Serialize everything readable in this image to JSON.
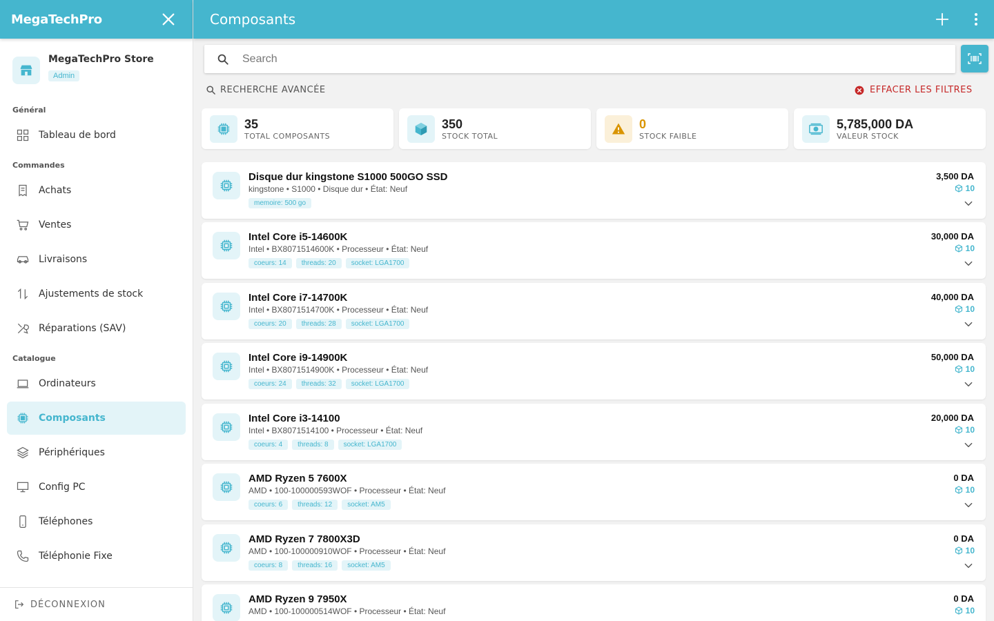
{
  "sidebar": {
    "brand": "MegaTechPro",
    "store_name": "MegaTechPro Store",
    "store_role": "Admin",
    "sections": [
      "Général",
      "Commandes",
      "Catalogue"
    ],
    "items": [
      {
        "label": "Tableau de bord",
        "icon": "grid-icon"
      },
      {
        "label": "Achats",
        "icon": "receipt-icon"
      },
      {
        "label": "Ventes",
        "icon": "cart-icon"
      },
      {
        "label": "Livraisons",
        "icon": "car-icon"
      },
      {
        "label": "Ajustements de stock",
        "icon": "swap-vertical-icon"
      },
      {
        "label": "Réparations (SAV)",
        "icon": "tools-icon"
      },
      {
        "label": "Ordinateurs",
        "icon": "laptop-icon"
      },
      {
        "label": "Composants",
        "icon": "chip-icon",
        "active": true
      },
      {
        "label": "Périphériques",
        "icon": "layers-icon"
      },
      {
        "label": "Config PC",
        "icon": "monitor-icon"
      },
      {
        "label": "Téléphones",
        "icon": "phone-icon"
      },
      {
        "label": "Téléphonie Fixe",
        "icon": "landline-icon"
      }
    ],
    "logout_label": "DÉCONNEXION"
  },
  "header": {
    "title": "Composants"
  },
  "search": {
    "placeholder": "Search"
  },
  "filters": {
    "advanced_label": "RECHERCHE AVANCÉE",
    "clear_label": "EFFACER LES FILTRES"
  },
  "stats": [
    {
      "value": "35",
      "label": "TOTAL COMPOSANTS",
      "icon": "chip-icon"
    },
    {
      "value": "350",
      "label": "STOCK TOTAL",
      "icon": "cube-icon"
    },
    {
      "value": "0",
      "label": "STOCK FAIBLE",
      "icon": "warning-icon"
    },
    {
      "value": "5,785,000 DA",
      "label": "VALEUR STOCK",
      "icon": "money-icon"
    }
  ],
  "products": [
    {
      "name": "Disque dur kingstone S1000 500GO SSD",
      "subtitle": "kingstone • S1000 • Disque dur • État: Neuf",
      "tags": [
        "memoire: 500 go"
      ],
      "price": "3,500 DA",
      "stock": "10"
    },
    {
      "name": "Intel Core i5-14600K",
      "subtitle": "Intel • BX8071514600K • Processeur • État: Neuf",
      "tags": [
        "coeurs: 14",
        "threads: 20",
        "socket: LGA1700"
      ],
      "price": "30,000 DA",
      "stock": "10"
    },
    {
      "name": "Intel Core i7-14700K",
      "subtitle": "Intel • BX8071514700K • Processeur • État: Neuf",
      "tags": [
        "coeurs: 20",
        "threads: 28",
        "socket: LGA1700"
      ],
      "price": "40,000 DA",
      "stock": "10"
    },
    {
      "name": "Intel Core i9-14900K",
      "subtitle": "Intel • BX8071514900K • Processeur • État: Neuf",
      "tags": [
        "coeurs: 24",
        "threads: 32",
        "socket: LGA1700"
      ],
      "price": "50,000 DA",
      "stock": "10"
    },
    {
      "name": "Intel Core i3-14100",
      "subtitle": "Intel • BX8071514100 • Processeur • État: Neuf",
      "tags": [
        "coeurs: 4",
        "threads: 8",
        "socket: LGA1700"
      ],
      "price": "20,000 DA",
      "stock": "10"
    },
    {
      "name": "AMD Ryzen 5 7600X",
      "subtitle": "AMD • 100-100000593WOF • Processeur • État: Neuf",
      "tags": [
        "coeurs: 6",
        "threads: 12",
        "socket: AM5"
      ],
      "price": "0 DA",
      "stock": "10"
    },
    {
      "name": "AMD Ryzen 7 7800X3D",
      "subtitle": "AMD • 100-100000910WOF • Processeur • État: Neuf",
      "tags": [
        "coeurs: 8",
        "threads: 16",
        "socket: AM5"
      ],
      "price": "0 DA",
      "stock": "10"
    },
    {
      "name": "AMD Ryzen 9 7950X",
      "subtitle": "AMD • 100-100000514WOF • Processeur • État: Neuf",
      "tags": [],
      "price": "0 DA",
      "stock": "10"
    }
  ],
  "colors": {
    "accent": "#45b6ce",
    "accent_light": "#e3f4f8",
    "warning": "#d99400",
    "danger": "#c62828"
  }
}
